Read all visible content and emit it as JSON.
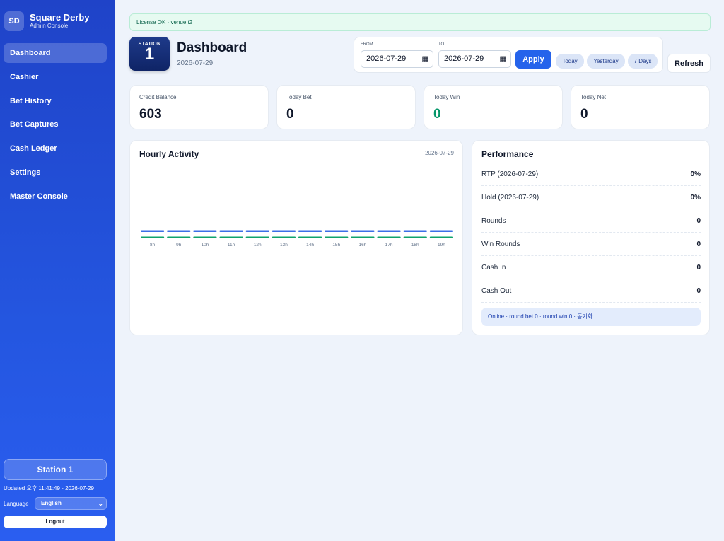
{
  "brand": {
    "badge": "SD",
    "title": "Square Derby",
    "subtitle": "Admin Console"
  },
  "nav": {
    "items": [
      {
        "label": "Dashboard",
        "active": true
      },
      {
        "label": "Cashier"
      },
      {
        "label": "Bet History"
      },
      {
        "label": "Bet Captures"
      },
      {
        "label": "Cash Ledger"
      },
      {
        "label": "Settings"
      },
      {
        "label": "Master Console"
      }
    ]
  },
  "sidebar_footer": {
    "station": "Station 1",
    "updated": "Updated 오후 11:41:49 - 2026-07-29",
    "language_label": "Language",
    "language_value": "English",
    "logout": "Logout"
  },
  "license": "License OK · venue t2",
  "header": {
    "station_label": "STATION",
    "station_number": "1",
    "title": "Dashboard",
    "date": "2026-07-29"
  },
  "range": {
    "from_label": "FROM",
    "to_label": "TO",
    "from_value": "2026-07-29",
    "to_value": "2026-07-29",
    "apply": "Apply",
    "chips": [
      "Today",
      "Yesterday",
      "7 Days"
    ]
  },
  "refresh": "Refresh",
  "stats": [
    {
      "label": "Credit Balance",
      "value": "603"
    },
    {
      "label": "Today Bet",
      "value": "0"
    },
    {
      "label": "Today Win",
      "value": "0",
      "color": "#059669"
    },
    {
      "label": "Today Net",
      "value": "0"
    }
  ],
  "hourly": {
    "title": "Hourly Activity",
    "date": "2026-07-29"
  },
  "chart_data": {
    "type": "bar",
    "categories": [
      "8h",
      "9h",
      "10h",
      "11h",
      "12h",
      "13h",
      "14h",
      "15h",
      "16h",
      "17h",
      "18h",
      "19h"
    ],
    "series": [
      {
        "values": [
          0,
          0,
          0,
          0,
          0,
          0,
          0,
          0,
          0,
          0,
          0,
          0
        ],
        "color": "#3b6fe6"
      },
      {
        "values": [
          0,
          0,
          0,
          0,
          0,
          0,
          0,
          0,
          0,
          0,
          0,
          0
        ],
        "color": "#10a36b"
      }
    ],
    "title": "Hourly Activity",
    "xlabel": "",
    "ylabel": ""
  },
  "performance": {
    "title": "Performance",
    "rows": [
      {
        "label": "RTP (2026-07-29)",
        "value": "0%"
      },
      {
        "label": "Hold (2026-07-29)",
        "value": "0%"
      },
      {
        "label": "Rounds",
        "value": "0"
      },
      {
        "label": "Win Rounds",
        "value": "0"
      },
      {
        "label": "Cash In",
        "value": "0"
      },
      {
        "label": "Cash Out",
        "value": "0"
      }
    ],
    "note": "Online · round bet 0 · round win 0 · 동기화"
  }
}
